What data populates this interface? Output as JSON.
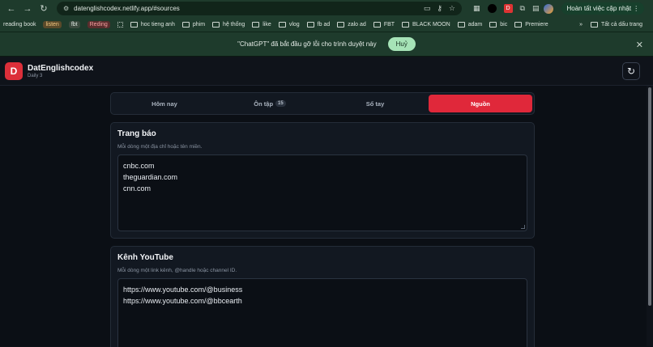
{
  "browser": {
    "url": "datenglishcodex.netlify.app/#sources",
    "update_button": "Hoàn tất việc cập nhật",
    "ext_badge": "D",
    "bookmarks": [
      {
        "label": "reading book",
        "type": "text"
      },
      {
        "label": "listen",
        "type": "chip-listen"
      },
      {
        "label": "fbt",
        "type": "chip"
      },
      {
        "label": "Reding",
        "type": "chip-reding"
      },
      {
        "label": "",
        "type": "apps"
      },
      {
        "label": "hoc tieng anh",
        "type": "folder"
      },
      {
        "label": "phim",
        "type": "folder"
      },
      {
        "label": "hệ thống",
        "type": "folder"
      },
      {
        "label": "like",
        "type": "folder"
      },
      {
        "label": "vlog",
        "type": "folder"
      },
      {
        "label": "fb ad",
        "type": "folder"
      },
      {
        "label": "zalo ad",
        "type": "folder"
      },
      {
        "label": "FBT",
        "type": "folder"
      },
      {
        "label": "BLACK MOON",
        "type": "folder"
      },
      {
        "label": "adam",
        "type": "folder"
      },
      {
        "label": "bic",
        "type": "folder"
      },
      {
        "label": "Premiere",
        "type": "folder"
      }
    ],
    "bookmarks_more": "»",
    "all_bookmarks": "Tất cả dấu trang"
  },
  "infobar": {
    "message": "\"ChatGPT\" đã bắt đầu gỡ lỗi cho trình duyệt này",
    "cancel_label": "Huỷ",
    "close_glyph": "✕"
  },
  "app": {
    "logo_letter": "D",
    "name": "DatEnglishcodex",
    "subtitle": "Daily 3",
    "refresh_glyph": "↻"
  },
  "tabs": [
    {
      "label": "Hôm nay",
      "badge": null,
      "active": false
    },
    {
      "label": "Ôn tập",
      "badge": "15",
      "active": false
    },
    {
      "label": "Sổ tay",
      "badge": null,
      "active": false
    },
    {
      "label": "Nguồn",
      "badge": null,
      "active": true
    }
  ],
  "sections": {
    "news": {
      "title": "Trang báo",
      "hint": "Mỗi dòng một địa chỉ hoặc tên miền.",
      "lines": [
        "cnbc.com",
        "theguardian.com",
        "cnn.com"
      ]
    },
    "youtube": {
      "title": "Kênh YouTube",
      "hint": "Mỗi dòng một link kênh, @handle hoặc channel ID.",
      "lines": [
        "https://www.youtube.com/@business",
        "https://www.youtube.com/@bbcearth"
      ]
    }
  },
  "colors": {
    "accent": "#e0283a",
    "chrome": "#1e3b2c",
    "background": "#0b0f15"
  }
}
